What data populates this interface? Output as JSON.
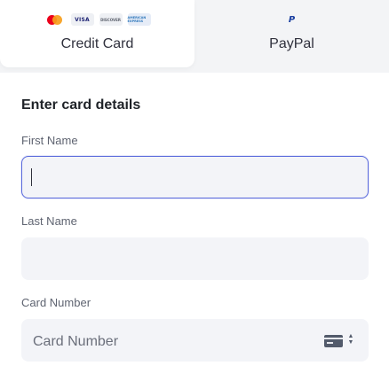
{
  "payment_methods": {
    "card": {
      "label": "Credit Card",
      "brands": [
        "mastercard-icon",
        "visa-icon",
        "discover-icon",
        "amex-icon"
      ],
      "visa_text": "VISA",
      "discover_text": "DISCOVER",
      "amex_text": "AMERICAN EXPRESS"
    },
    "paypal": {
      "label": "PayPal",
      "icon": "paypal-icon",
      "icon_text": "P"
    }
  },
  "form": {
    "title": "Enter card details",
    "first_name": {
      "label": "First Name",
      "value": ""
    },
    "last_name": {
      "label": "Last Name",
      "value": ""
    },
    "card_number": {
      "label": "Card Number",
      "placeholder": "Card Number"
    }
  },
  "colors": {
    "accent": "#5b6bdc",
    "input_bg": "#f3f4f8",
    "tab_bar_bg": "#f3f4f6"
  }
}
